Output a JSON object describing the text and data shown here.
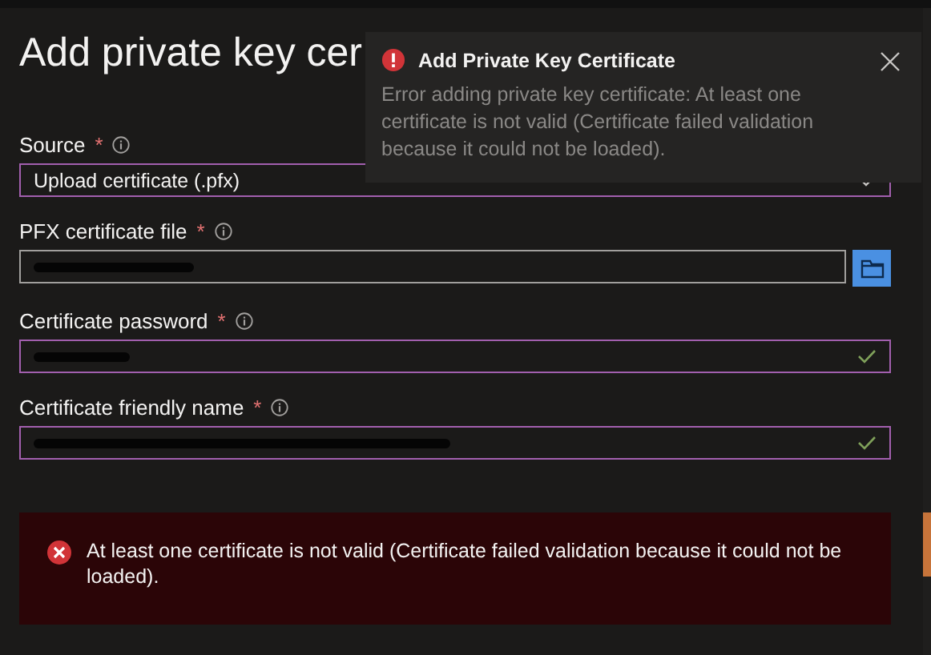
{
  "page": {
    "title": "Add private key cer"
  },
  "toast": {
    "title": "Add Private Key Certificate",
    "message": "Error adding private key certificate: At least one certificate is not valid (Certificate failed validation because it could not be loaded)."
  },
  "fields": [
    {
      "kind": "select",
      "label": "Source",
      "required_mark": "*",
      "value": "Upload certificate (.pfx)",
      "redacted": false,
      "valid": false
    },
    {
      "kind": "file",
      "label": "PFX certificate file",
      "required_mark": "*",
      "redacted": true,
      "valid": false
    },
    {
      "kind": "text",
      "label": "Certificate password",
      "required_mark": "*",
      "redacted": true,
      "valid": true
    },
    {
      "kind": "text",
      "label": "Certificate friendly name",
      "required_mark": "*",
      "redacted": true,
      "valid": true
    }
  ],
  "error_banner": {
    "message": "At least one certificate is not valid (Certificate failed validation because it could not be loaded)."
  }
}
